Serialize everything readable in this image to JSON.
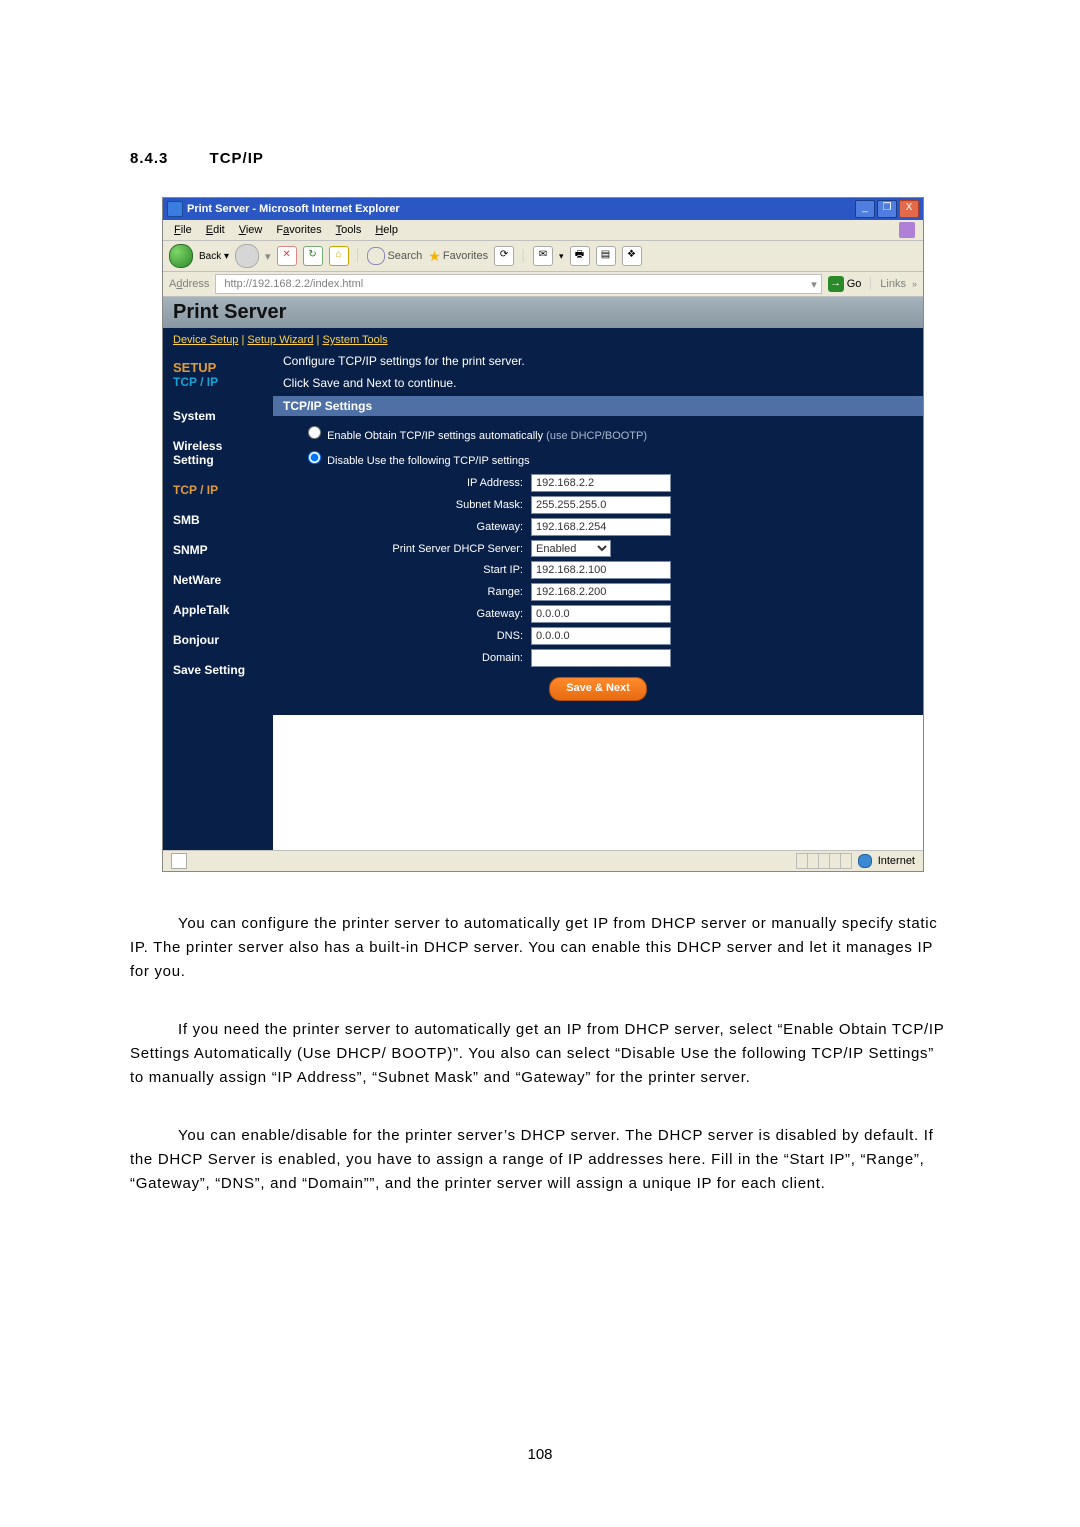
{
  "section": {
    "number": "8.4.3",
    "title": "TCP/IP"
  },
  "window": {
    "title": "Print Server - Microsoft Internet Explorer",
    "win_min": "_",
    "win_max": "❐",
    "win_close": "X",
    "menus": [
      "File",
      "Edit",
      "View",
      "Favorites",
      "Tools",
      "Help"
    ],
    "search_label": "Search",
    "favorites_label": "Favorites",
    "address_label": "Address",
    "address_value": "http://192.168.2.2/index.html",
    "go_label": "Go",
    "links_label": "Links",
    "status_internet": "Internet"
  },
  "ps": {
    "banner": "Print Server",
    "crumbs": {
      "a": "Device Setup",
      "b": "Setup Wizard",
      "c": "System Tools",
      "sep": " | "
    },
    "setup_top": "SETUP",
    "setup_sub": "TCP / IP",
    "sidebar": [
      "System",
      "Wireless Setting",
      "TCP / IP",
      "SMB",
      "SNMP",
      "NetWare",
      "AppleTalk",
      "Bonjour",
      "Save Setting"
    ],
    "desc1": "Configure TCP/IP settings for the print server.",
    "desc2": "Click Save and Next to continue.",
    "subhead": "TCP/IP Settings",
    "opt_enable": "Enable Obtain TCP/IP settings automatically",
    "opt_enable_hint": "(use DHCP/BOOTP)",
    "opt_disable": "Disable Use the following TCP/IP settings",
    "form": {
      "ip_label": "IP Address:",
      "ip_value": "192.168.2.2",
      "mask_label": "Subnet Mask:",
      "mask_value": "255.255.255.0",
      "gw_label": "Gateway:",
      "gw_value": "192.168.2.254",
      "dhcp_label": "Print Server DHCP Server:",
      "dhcp_value": "Enabled",
      "start_label": "Start IP:",
      "start_value": "192.168.2.100",
      "range_label": "Range:",
      "range_value": "192.168.2.200",
      "gw2_label": "Gateway:",
      "gw2_value": "0.0.0.0",
      "dns_label": "DNS:",
      "dns_value": "0.0.0.0",
      "domain_label": "Domain:",
      "domain_value": ""
    },
    "save_btn": "Save & Next"
  },
  "body": {
    "p1": "You can configure the printer server to automatically get IP from DHCP server or manually specify static IP. The printer server also has a built-in DHCP server. You can enable this DHCP server and let it manages IP for you.",
    "p2": "If you need the printer server to automatically get an IP from DHCP server, select “Enable Obtain TCP/IP Settings Automatically (Use DHCP/ BOOTP)”. You also can select “Disable Use the following TCP/IP Settings” to manually assign “IP Address”, “Subnet Mask” and “Gateway” for the printer server.",
    "p3": "You can enable/disable for the printer server’s DHCP server. The DHCP server is disabled by default. If the DHCP Server is enabled, you have to assign a range of IP addresses here. Fill in the “Start IP”, “Range”, “Gateway”, “DNS”, and “Domain””, and the printer server will assign a unique IP for each client."
  },
  "page_number": "108"
}
